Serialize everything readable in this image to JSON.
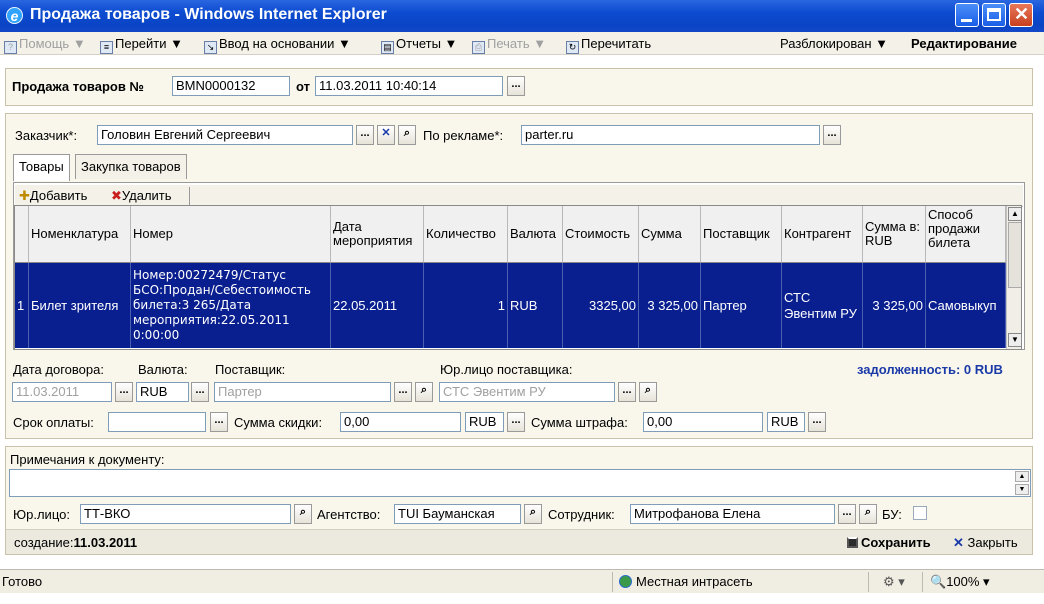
{
  "window": {
    "title": "Продажа товаров - Windows Internet Explorer"
  },
  "menu": {
    "help": "Помощь",
    "goto": "Перейти",
    "enter_based": "Ввод на основании",
    "reports": "Отчеты",
    "print": "Печать",
    "reread": "Перечитать",
    "unlocked": "Разблокирован",
    "editing": "Редактирование"
  },
  "header": {
    "doc_label": "Продажа товаров №",
    "doc_number": "BMN0000132",
    "from_label": "от",
    "date": "11.03.2011 10:40:14"
  },
  "customer": {
    "label": "Заказчик*:",
    "value": "Головин Евгений Сергеевич",
    "ad_label": "По рекламе*:",
    "ad_value": "parter.ru"
  },
  "tabs": [
    "Товары",
    "Закупка товаров"
  ],
  "grid_toolbar": {
    "add": "Добавить",
    "delete": "Удалить"
  },
  "grid": {
    "columns": [
      "Номенклатура",
      "Номер",
      "Дата мероприятия",
      "Количество",
      "Валюта",
      "Стоимость",
      "Сумма",
      "Поставщик",
      "Контрагент",
      "Сумма в: RUB",
      "Способ продажи билета"
    ],
    "rows": [
      {
        "n": "1",
        "nomenclature": "Билет зрителя",
        "number": "Номер:00272479/Статус БСО:Продан/Себестоимость билета:3 265/Дата мероприятия:22.05.2011 0:00:00",
        "event_date": "22.05.2011",
        "qty": "1",
        "currency": "RUB",
        "cost": "3325,00",
        "sum": "3 325,00",
        "supplier": "Партер",
        "contractor": "СТС Эвентим РУ",
        "sum_rub": "3 325,00",
        "sale_method": "Самовыкуп"
      }
    ]
  },
  "details": {
    "contract_date_label": "Дата договора:",
    "contract_date": "11.03.2011",
    "currency_label": "Валюта:",
    "currency": "RUB",
    "supplier_label": "Поставщик:",
    "supplier": "Партер",
    "supplier_entity_label": "Юр.лицо поставщика:",
    "supplier_entity": "СТС Эвентим РУ",
    "debt": "задолженность: 0 RUB",
    "pay_term_label": "Срок оплаты:",
    "pay_term": "",
    "discount_label": "Сумма скидки:",
    "discount": "0,00",
    "discount_currency": "RUB",
    "penalty_label": "Сумма штрафа:",
    "penalty": "0,00",
    "penalty_currency": "RUB"
  },
  "notes": {
    "label": "Примечания к документу:",
    "value": ""
  },
  "footer": {
    "entity_label": "Юр.лицо:",
    "entity": "ТТ-ВКО",
    "agency_label": "Агентство:",
    "agency": "TUI Бауманская",
    "employee_label": "Сотрудник:",
    "employee": "Митрофанова Елена",
    "bu_label": "БУ:",
    "created_label": "создание:",
    "created_date": "11.03.2011",
    "save": "Сохранить",
    "close": "Закрыть"
  },
  "status": {
    "ready": "Готово",
    "zone": "Местная интрасеть",
    "zoom": "100%"
  },
  "colors": {
    "selection": "#0a1f8f",
    "debt": "#1a3aa8",
    "titlebar": "#0c4bd0"
  }
}
